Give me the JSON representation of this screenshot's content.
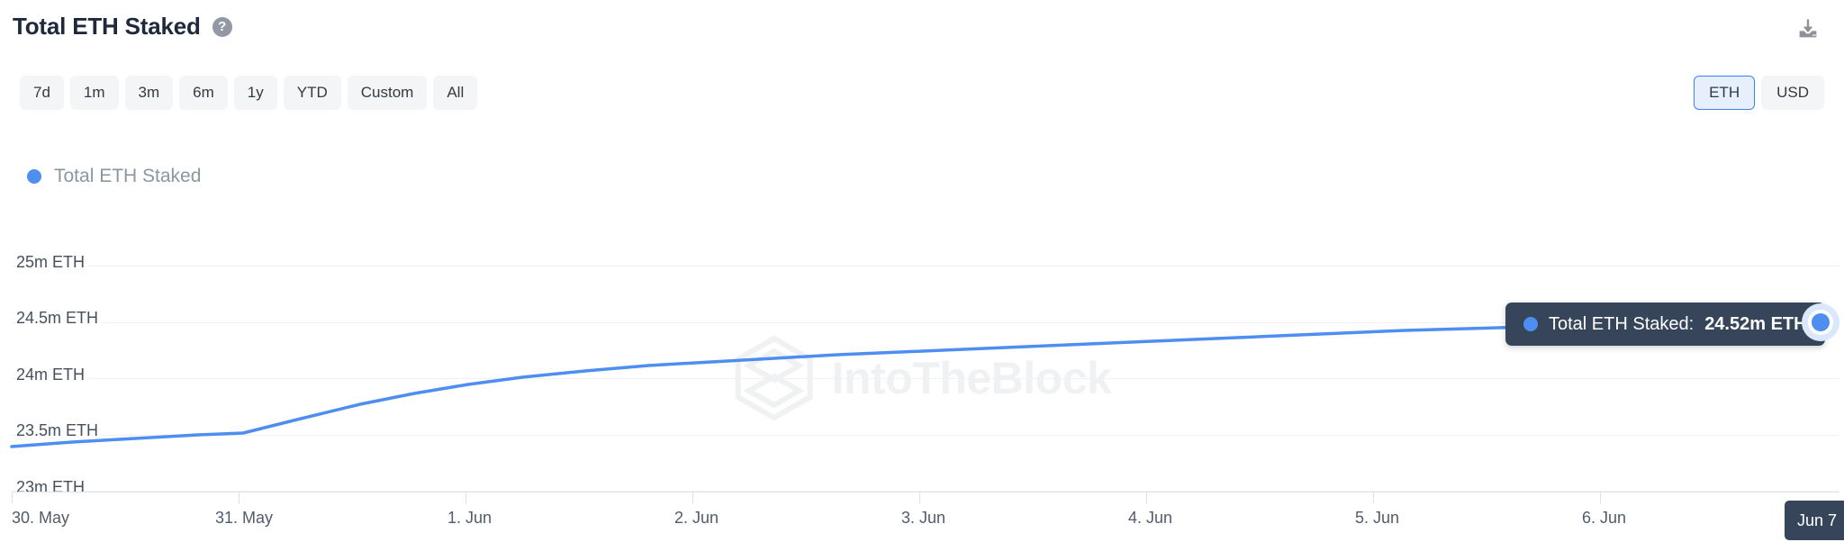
{
  "header": {
    "title": "Total ETH Staked",
    "help_icon": "question-mark-icon",
    "help_glyph": "?",
    "download_icon": "download-icon"
  },
  "controls": {
    "ranges": [
      {
        "label": "7d",
        "active": false
      },
      {
        "label": "1m",
        "active": false
      },
      {
        "label": "3m",
        "active": false
      },
      {
        "label": "6m",
        "active": false
      },
      {
        "label": "1y",
        "active": false
      },
      {
        "label": "YTD",
        "active": false
      },
      {
        "label": "Custom",
        "active": false
      },
      {
        "label": "All",
        "active": false
      }
    ],
    "units": [
      {
        "label": "ETH",
        "active": true
      },
      {
        "label": "USD",
        "active": false
      }
    ]
  },
  "legend": {
    "label": "Total ETH Staked",
    "color": "#4e8ef0"
  },
  "watermark": {
    "text": "IntoTheBlock",
    "logo_icon": "cube-logo-icon"
  },
  "tooltip": {
    "series_label": "Total ETH Staked:",
    "value": "24.52m ETH",
    "dot_color": "#4e8ef0",
    "background": "#36455a"
  },
  "crosshair": {
    "date_label": "Jun 7"
  },
  "chart_data": {
    "type": "line",
    "title": "Total ETH Staked",
    "xlabel": "",
    "ylabel": "ETH",
    "unit": "ETH",
    "grid": true,
    "legend_position": "top-left",
    "line_color": "#4e8ef0",
    "ylim": [
      23000000,
      25000000
    ],
    "ytick_labels": [
      "25m ETH",
      "24.5m ETH",
      "24m ETH",
      "23.5m ETH",
      "23m ETH"
    ],
    "ytick_values": [
      25000000,
      24500000,
      24000000,
      23500000,
      23000000
    ],
    "xtick_labels": [
      "30. May",
      "31. May",
      "1. Jun",
      "2. Jun",
      "3. Jun",
      "4. Jun",
      "5. Jun",
      "6. Jun"
    ],
    "series": [
      {
        "name": "Total ETH Staked",
        "x": [
          "30. May",
          "31. May",
          "1. Jun",
          "2. Jun",
          "3. Jun",
          "4. Jun",
          "5. Jun",
          "6. Jun",
          "Jun 7"
        ],
        "values": [
          23430000,
          23530000,
          23880000,
          24060000,
          24180000,
          24260000,
          24340000,
          24440000,
          24520000
        ]
      }
    ],
    "highlighted_point": {
      "x": "Jun 7",
      "y": 24520000,
      "label": "24.52m ETH"
    }
  }
}
